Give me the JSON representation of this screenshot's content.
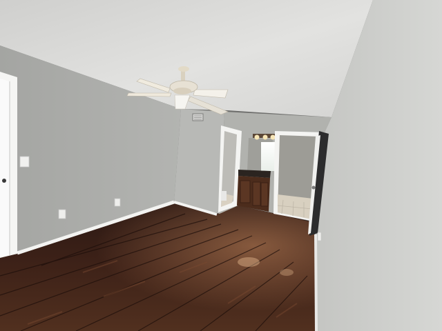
{
  "scene": {
    "colors": {
      "ceiling": "#dcdcda",
      "wall_left": "#a9aaa7",
      "wall_back": "#b9bab7",
      "wall_right": "#cfd0cd",
      "trim": "#f2f2f0",
      "floor_dark": "#2a1712",
      "floor_mid": "#4a2a1f",
      "floor_light": "#6b3d2a",
      "cabinet": "#4c2c1c",
      "bath_wall": "#9d9c96",
      "tile": "#d7cfc0",
      "fan": "#e7e1d4"
    },
    "objects": [
      {
        "name": "ceiling-fan-icon"
      },
      {
        "name": "interior-door-left"
      },
      {
        "name": "hallway-doorway"
      },
      {
        "name": "bathroom-vanity-cabinet"
      },
      {
        "name": "bathroom-doorway"
      },
      {
        "name": "open-door"
      },
      {
        "name": "vanity-light-fixture"
      },
      {
        "name": "air-vent"
      },
      {
        "name": "light-switch"
      },
      {
        "name": "electrical-outlet"
      },
      {
        "name": "hardwood-floor"
      }
    ]
  }
}
